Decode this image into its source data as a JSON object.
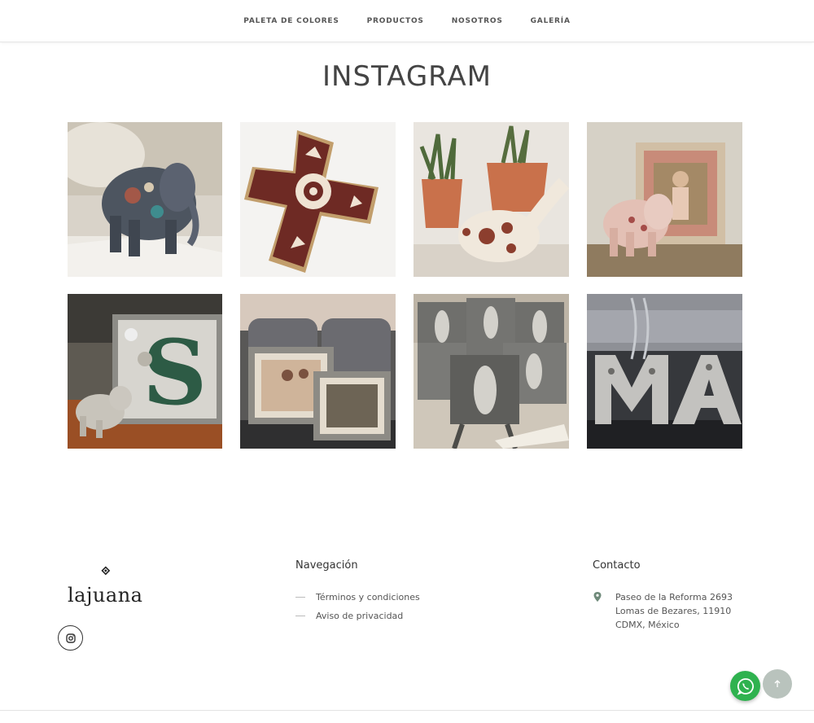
{
  "nav": {
    "items": [
      {
        "label": "PALETA DE COLORES"
      },
      {
        "label": "PRODUCTOS"
      },
      {
        "label": "NOSOTROS"
      },
      {
        "label": "GALERÍA"
      }
    ]
  },
  "section": {
    "title": "INSTAGRAM"
  },
  "instagram": {
    "posts": [
      {
        "subject": "beaded elephant"
      },
      {
        "subject": "beaded cross"
      },
      {
        "subject": "beaded bird and plants"
      },
      {
        "subject": "pink elephant with frame"
      },
      {
        "subject": "letter S box with elephant"
      },
      {
        "subject": "beaded photo frames"
      },
      {
        "subject": "beaded virgin tiles"
      },
      {
        "subject": "letters M A"
      }
    ]
  },
  "footer": {
    "brand": "lajuana",
    "social": {
      "icon": "instagram-icon"
    },
    "navigation": {
      "heading": "Navegación",
      "links": [
        "Términos y condiciones",
        "Aviso de privacidad"
      ]
    },
    "contact": {
      "heading": "Contacto",
      "address": [
        "Paseo de la Reforma 2693",
        "Lomas de Bezares, 11910",
        "CDMX, México"
      ]
    }
  },
  "floating": {
    "whatsapp_icon": "whatsapp-icon",
    "scroll_top_icon": "arrow-up-icon",
    "whatsapp_color": "#2fb24f",
    "scroll_top_color": "#b9c3bd"
  }
}
